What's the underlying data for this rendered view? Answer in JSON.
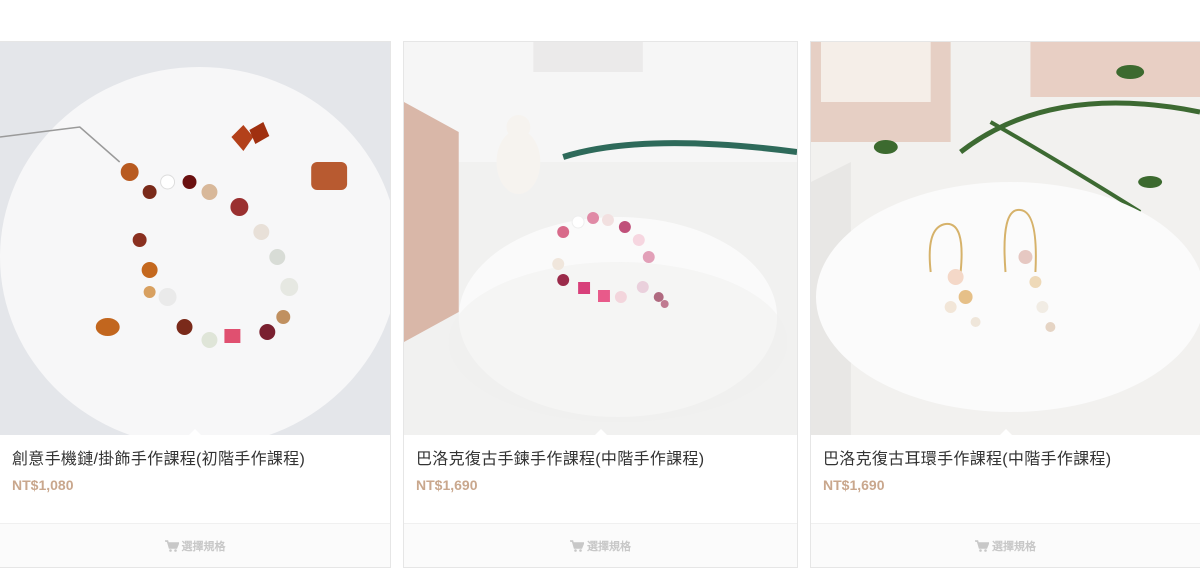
{
  "products": [
    {
      "title": "創意手機鏈/掛飾手作課程(初階手作課程)",
      "price": "NT$1,080",
      "button": "選擇規格",
      "image_alt": "beaded phone charm on white plate"
    },
    {
      "title": "巴洛克復古手鍊手作課程(中階手作課程)",
      "price": "NT$1,690",
      "button": "選擇規格",
      "image_alt": "pink beaded bracelet on white tray"
    },
    {
      "title": "巴洛克復古耳環手作課程(中階手作課程)",
      "price": "NT$1,690",
      "button": "選擇規格",
      "image_alt": "pearl flower earrings on white tray"
    }
  ],
  "icons": {
    "cart": "cart-icon"
  },
  "colors": {
    "price": "#c9a78d",
    "button_text": "#c8c8c8",
    "title": "#333333"
  }
}
